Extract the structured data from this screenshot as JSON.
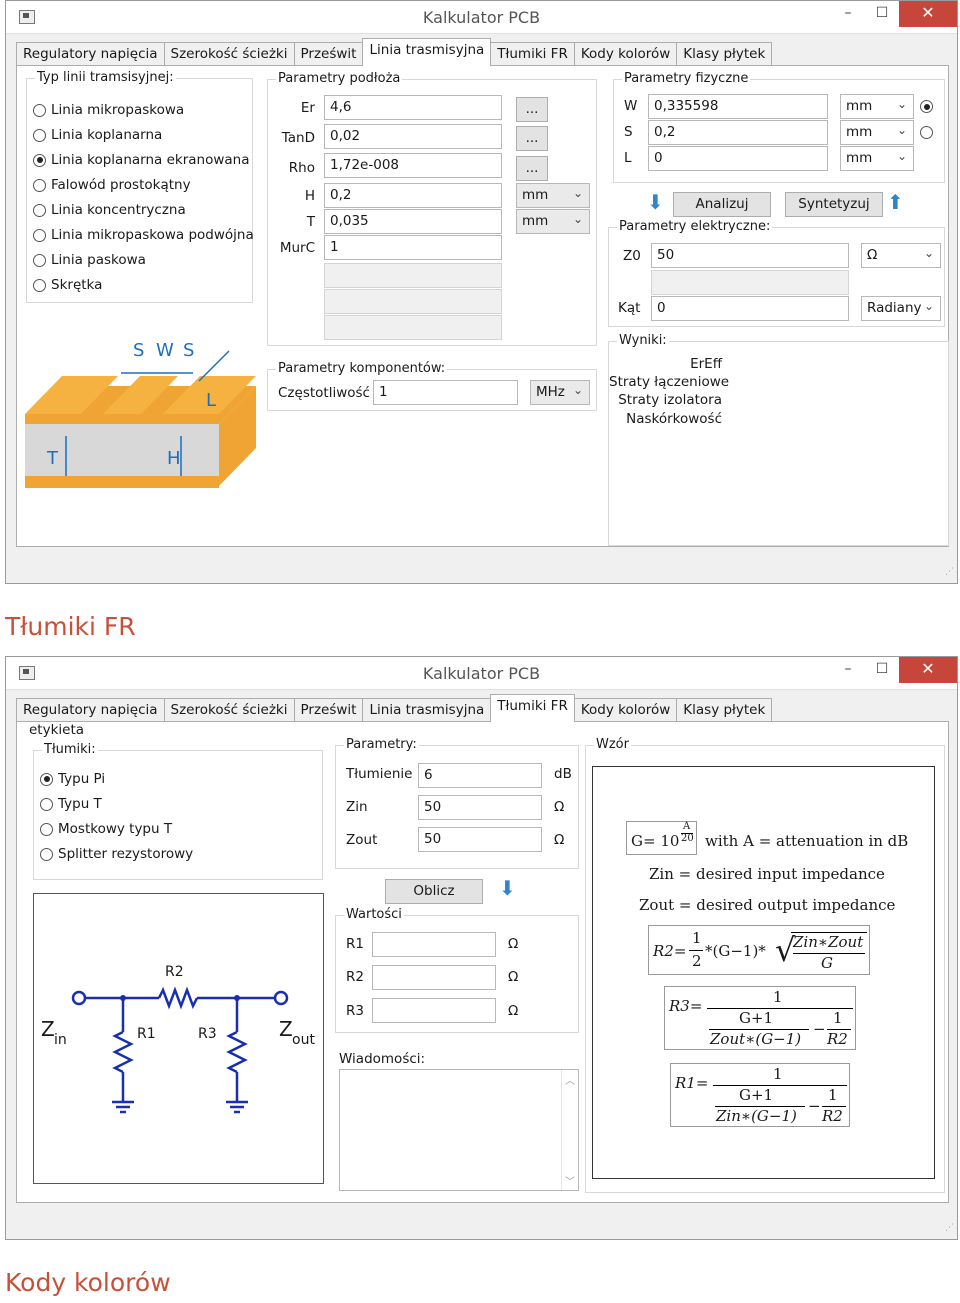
{
  "window1": {
    "title": "Kalkulator PCB",
    "tabs": [
      "Regulatory napięcia",
      "Szerokość ścieżki",
      "Prześwit",
      "Linia trasmisyjna",
      "Tłumiki FR",
      "Kody kolorów",
      "Klasy płytek"
    ],
    "line_type": {
      "label": "Typ linii tramsisyjnej:",
      "options": [
        "Linia mikropaskowa",
        "Linia koplanarna",
        "Linia koplanarna ekranowana",
        "Falowód prostokątny",
        "Linia koncentryczna",
        "Linia mikropaskowa podwójna",
        "Linia paskowa",
        "Skrętka"
      ],
      "selected": "Linia koplanarna ekranowana"
    },
    "diagram": {
      "s1": "S",
      "w": "W",
      "s2": "S",
      "l": "L",
      "t": "T",
      "h": "H"
    },
    "substrate": {
      "label": "Parametry podłoża",
      "rows": [
        {
          "name": "Er",
          "value": "4,6",
          "button": "..."
        },
        {
          "name": "TanD",
          "value": "0,02",
          "button": "..."
        },
        {
          "name": "Rho",
          "value": "1,72e-008",
          "button": "..."
        },
        {
          "name": "H",
          "value": "0,2",
          "unit": "mm"
        },
        {
          "name": "T",
          "value": "0,035",
          "unit": "mm"
        },
        {
          "name": "MurC",
          "value": "1"
        }
      ]
    },
    "components": {
      "label": "Parametry komponentów:",
      "freq_label": "Częstotliwość",
      "freq_value": "1",
      "freq_unit": "MHz"
    },
    "physical": {
      "label": "Parametry fizyczne",
      "rows": [
        {
          "name": "W",
          "value": "0,335598",
          "unit": "mm"
        },
        {
          "name": "S",
          "value": "0,2",
          "unit": "mm"
        },
        {
          "name": "L",
          "value": "0",
          "unit": "mm"
        }
      ]
    },
    "analyze_label": "Analizuj",
    "synthesize_label": "Syntetyzuj",
    "electrical": {
      "label": "Parametry elektryczne:",
      "z0_label": "Z0",
      "z0_value": "50",
      "z0_unit": "Ω",
      "angle_label": "Kąt",
      "angle_value": "0",
      "angle_unit": "Radiany"
    },
    "results": {
      "label": "Wyniki:",
      "lines": [
        "ErEff",
        "Straty łączeniowe",
        "Straty izolatora",
        "Naskórkowość"
      ]
    }
  },
  "section1_heading": "Tłumiki FR",
  "window2": {
    "title": "Kalkulator PCB",
    "tabs": [
      "Regulatory napięcia",
      "Szerokość ścieżki",
      "Prześwit",
      "Linia trasmisyjna",
      "Tłumiki FR",
      "Kody kolorów",
      "Klasy płytek"
    ],
    "etykieta": "etykieta",
    "attenuators": {
      "label": "Tłumiki:",
      "options": [
        "Typu Pi",
        "Typu T",
        "Mostkowy typu T",
        "Splitter rezystorowy"
      ],
      "selected": "Typu Pi"
    },
    "circuit": {
      "r1": "R1",
      "r2": "R2",
      "r3": "R3",
      "zin": "Z",
      "zin_sub": "in",
      "zout": "Z",
      "zout_sub": "out"
    },
    "params": {
      "label": "Parametry:",
      "rows": [
        {
          "name": "Tłumienie",
          "value": "6",
          "unit": "dB"
        },
        {
          "name": "Zin",
          "value": "50",
          "unit": "Ω"
        },
        {
          "name": "Zout",
          "value": "50",
          "unit": "Ω"
        }
      ]
    },
    "calc_label": "Oblicz",
    "values": {
      "label": "Wartości",
      "rows": [
        {
          "name": "R1",
          "unit": "Ω"
        },
        {
          "name": "R2",
          "unit": "Ω"
        },
        {
          "name": "R3",
          "unit": "Ω"
        }
      ]
    },
    "messages_label": "Wiadomości:",
    "formula": {
      "label": "Wzór",
      "g_eq": "G= 10",
      "g_exp_num": "A",
      "g_exp_den": "20",
      "g_note": "with  A = attenuation in dB",
      "zin_def": "Zin = desired input impedance",
      "zout_def": "Zout = desired output impedance",
      "r2_lhs": "R2=",
      "r2_half_num": "1",
      "r2_half_den": "2",
      "r2_mid": "*(G−1)*",
      "r2_sqrt_num": "Zin∗Zout",
      "r2_sqrt_den": "G",
      "r3_lhs": "R3=",
      "r3_num": "1",
      "r3_a_num": "G+1",
      "r3_a_den": "Zout∗(G−1)",
      "r3_minus": "−",
      "r3_b_num": "1",
      "r3_b_den": "R2",
      "r1_lhs": "R1=",
      "r1_num": "1",
      "r1_a_num": "G+1",
      "r1_a_den": "Zin∗(G−1)",
      "r1_minus": "−",
      "r1_b_num": "1",
      "r1_b_den": "R2"
    }
  },
  "section2_heading": "Kody kolorów",
  "window_controls": {
    "minimize": "–",
    "maximize": "☐",
    "close": "✕"
  }
}
